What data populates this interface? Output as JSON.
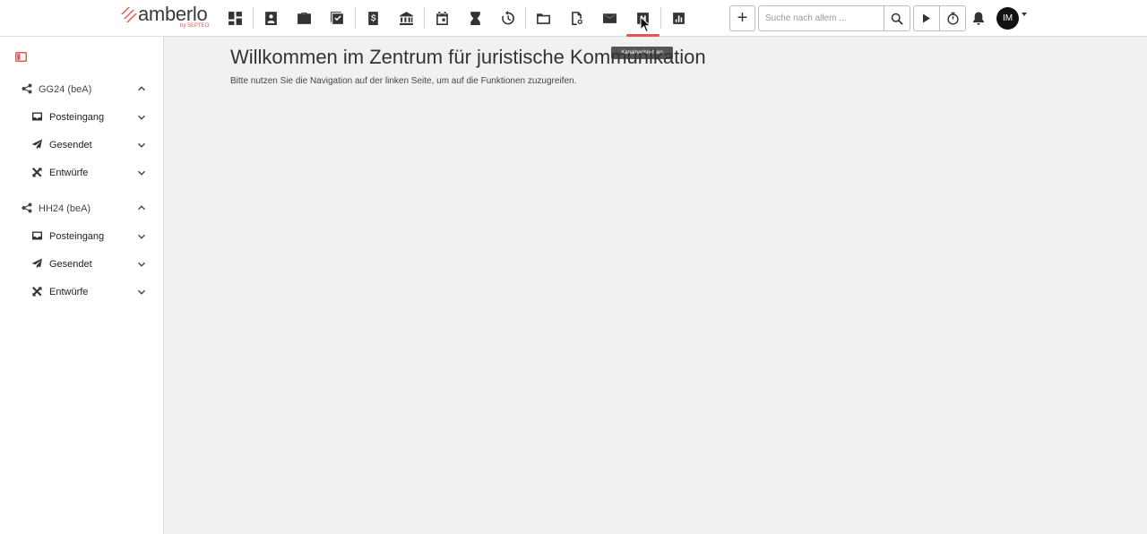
{
  "brand": {
    "name": "amberlo",
    "byline": "by SEPTEO",
    "accent": "#e8554e"
  },
  "toolbar": {
    "icons": [
      "dashboard-icon",
      "contacts-icon",
      "matters-icon",
      "tasks-icon",
      "billing-icon",
      "bank-icon",
      "calendar-icon",
      "deadlines-icon",
      "time-history-icon",
      "documents-icon",
      "document-search-icon",
      "email-icon",
      "channel-messages-icon",
      "reports-icon"
    ],
    "active": "channel-messages-icon",
    "tooltip": "Kanalnachrichten",
    "add_label": "+",
    "search_placeholder": "Suche nach allem ...",
    "avatar_initials": "IM"
  },
  "sidebar": {
    "accounts": [
      {
        "label": "GG24 (beA)",
        "expanded": true,
        "folders": [
          {
            "label": "Posteingang",
            "icon": "inbox-icon"
          },
          {
            "label": "Gesendet",
            "icon": "sent-icon"
          },
          {
            "label": "Entwürfe",
            "icon": "drafts-icon"
          }
        ]
      },
      {
        "label": "HH24 (beA)",
        "expanded": true,
        "folders": [
          {
            "label": "Posteingang",
            "icon": "inbox-icon"
          },
          {
            "label": "Gesendet",
            "icon": "sent-icon"
          },
          {
            "label": "Entwürfe",
            "icon": "drafts-icon"
          }
        ]
      }
    ]
  },
  "main": {
    "title": "Willkommen im Zentrum für juristische Kommunikation",
    "subtitle": "Bitte nutzen Sie die Navigation auf der linken Seite, um auf die Funktionen zuzugreifen."
  }
}
